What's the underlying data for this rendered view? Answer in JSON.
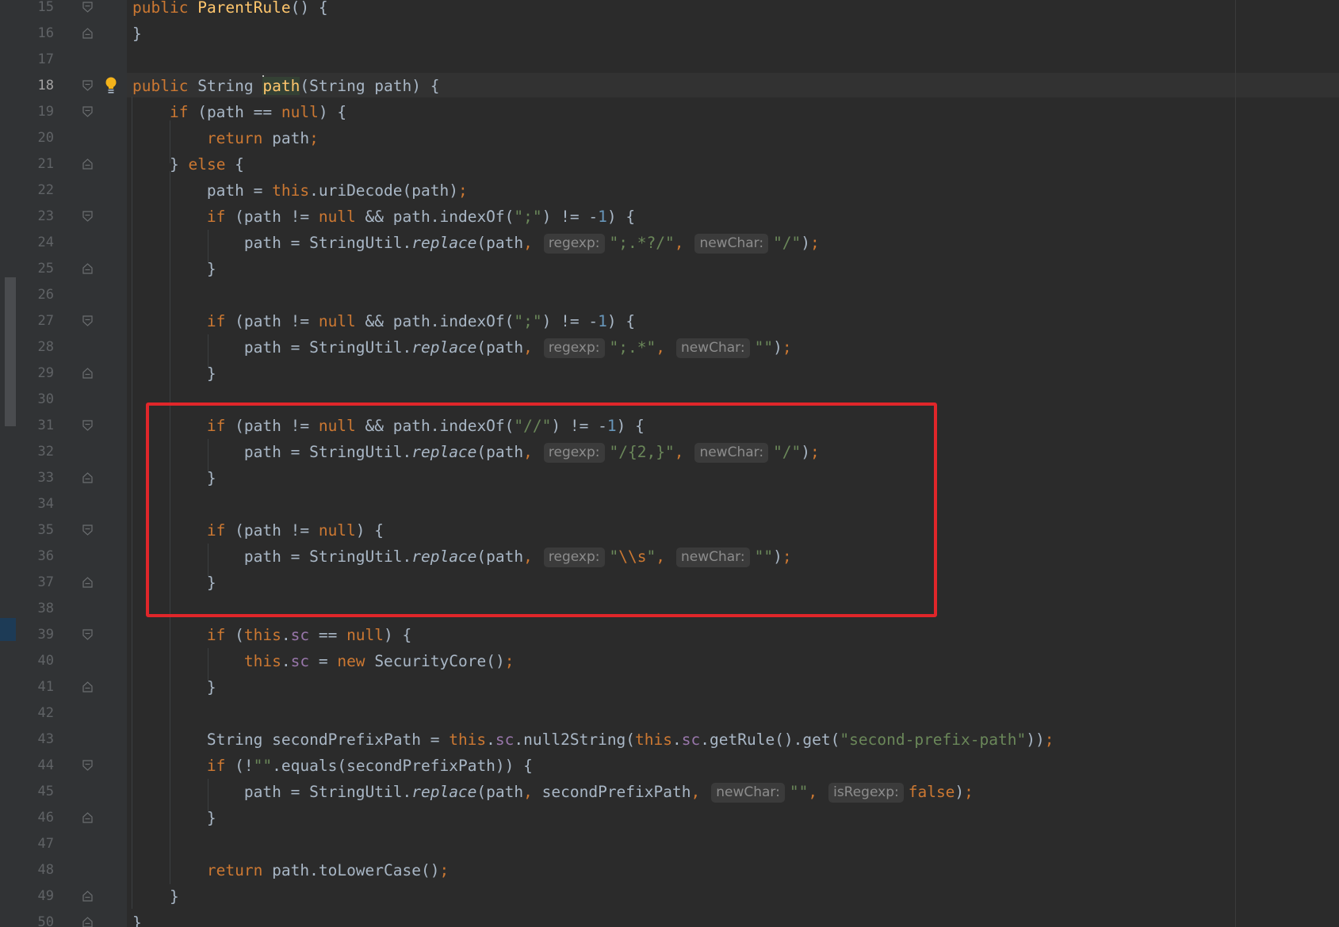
{
  "editor": {
    "highlight_color": "#e0262a",
    "current_line": "18",
    "lines": [
      {
        "num": "15"
      },
      {
        "num": "16"
      },
      {
        "num": "17"
      },
      {
        "num": "18"
      },
      {
        "num": "19"
      },
      {
        "num": "20"
      },
      {
        "num": "21"
      },
      {
        "num": "22"
      },
      {
        "num": "23"
      },
      {
        "num": "24"
      },
      {
        "num": "25"
      },
      {
        "num": "26"
      },
      {
        "num": "27"
      },
      {
        "num": "28"
      },
      {
        "num": "29"
      },
      {
        "num": "30"
      },
      {
        "num": "31"
      },
      {
        "num": "32"
      },
      {
        "num": "33"
      },
      {
        "num": "34"
      },
      {
        "num": "35"
      },
      {
        "num": "36"
      },
      {
        "num": "37"
      },
      {
        "num": "38"
      },
      {
        "num": "39"
      },
      {
        "num": "40"
      },
      {
        "num": "41"
      },
      {
        "num": "42"
      },
      {
        "num": "43"
      },
      {
        "num": "44"
      },
      {
        "num": "45"
      },
      {
        "num": "46"
      },
      {
        "num": "47"
      },
      {
        "num": "48"
      },
      {
        "num": "49"
      },
      {
        "num": "50"
      }
    ]
  },
  "tokens": {
    "public": "public",
    "ParentRule": "ParentRule",
    "parens": "()",
    "brace_open": " {",
    "brace_close": "}",
    "String": "String",
    "path": "path",
    "path_sig": "(String path) {",
    "if": "if",
    "else": "else",
    "return": "return",
    "null": "null",
    "this": "this",
    "new": "new",
    "false": "false",
    "sc": "sc",
    "SecurityCore": "SecurityCore",
    "secondPrefixPath": "secondPrefixPath",
    "StringUtil": "StringUtil.",
    "replace": "replace",
    "uriDecode": "uriDecode",
    "indexOf": "indexOf",
    "null2String": "null2String",
    "getRule": "getRule",
    "get": "get",
    "equals": "equals",
    "toLowerCase": "toLowerCase",
    "semi": ";",
    "comma": ",",
    "minus_one": "1"
  },
  "strings": {
    "semicolon": "\";\"",
    "double_slash": "\"//\"",
    "re_semi_slash": "\";.*?/\"",
    "re_semi_all": "\";.*\"",
    "re_multi_slash": "\"/{2,}\"",
    "re_space_open": "\"",
    "re_space_esc": "\\\\s",
    "re_space_close": "\"",
    "slash": "\"/\"",
    "empty": "\"\"",
    "second_prefix_path": "\"second-prefix-path\""
  },
  "hints": {
    "regexp": "regexp:",
    "newChar": "newChar:",
    "isRegexp": "isRegexp:"
  }
}
